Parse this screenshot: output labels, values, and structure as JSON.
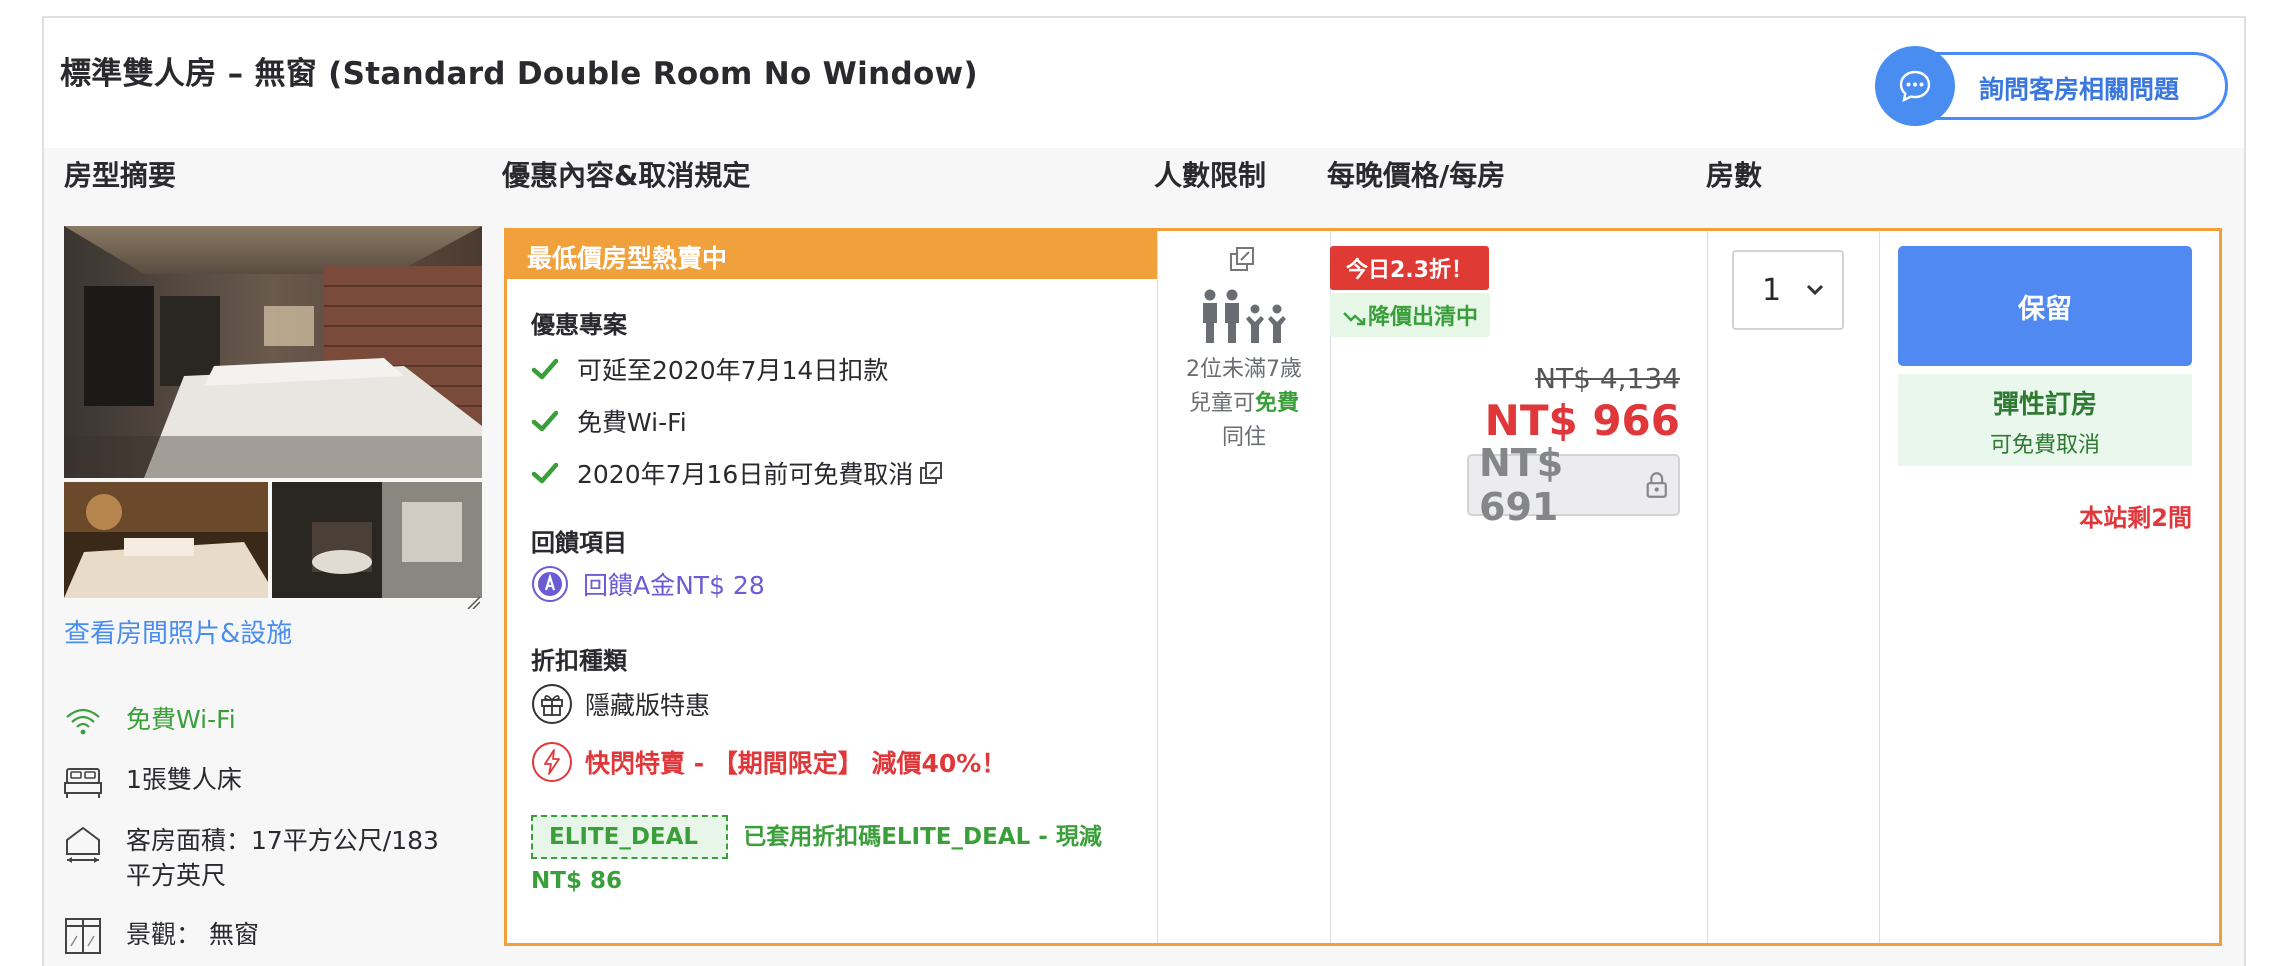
{
  "room": {
    "title": "標準雙人房 – 無窗 (Standard Double Room No Window)",
    "ask_button": "詢問客房相關問題"
  },
  "columns": {
    "summary": "房型摘要",
    "offers": "優惠內容&取消規定",
    "occupancy": "人數限制",
    "price": "每晚價格/每房",
    "rooms": "房數"
  },
  "gallery": {
    "view_link": "查看房間照片&設施"
  },
  "amenities": [
    {
      "label": "免費Wi-Fi",
      "icon": "wifi-icon",
      "color": "#3a9f3a"
    },
    {
      "label": "1張雙人床",
      "icon": "bed-icon"
    },
    {
      "label": "客房面積：17平方公尺/183平方英尺",
      "icon": "area-icon"
    },
    {
      "label": "景觀： 無窗",
      "icon": "window-icon"
    }
  ],
  "offer": {
    "banner": "最低價房型熱賣中",
    "promo_label": "優惠專案",
    "perks": [
      "可延至2020年7月14日扣款",
      "免費Wi-Fi",
      "2020年7月16日前可免費取消"
    ],
    "rebate_label": "回饋項目",
    "rebate": "回饋A金NT$ 28",
    "discount_label": "折扣種類",
    "hidden_deal": "隱藏版特惠",
    "flash_sale": "快閃特賣 - 【期間限定】 減價40%！",
    "coupon_code": "ELITE_DEAL",
    "coupon_text": "已套用折扣碼ELITE_DEAL - 現減",
    "coupon_amount": "NT$ 86"
  },
  "occupancy": {
    "line1": "2位未滿7歲",
    "line2a": "兒童可",
    "line2b": "免費",
    "line3": "同住"
  },
  "price": {
    "today_badge": "今日2.3折！",
    "drop_badge": "降價出清中",
    "original": "NT$ 4,134",
    "current": "NT$ 966",
    "member": "NT$ 691"
  },
  "booking": {
    "quantity": "1",
    "reserve": "保留",
    "flex_title": "彈性訂房",
    "flex_sub": "可免費取消",
    "rooms_left": "本站剩2間"
  },
  "colors": {
    "accent_orange": "#f0a13b",
    "primary_blue": "#5189f2",
    "sale_red": "#e0373a",
    "success_green": "#3a9f3a"
  }
}
